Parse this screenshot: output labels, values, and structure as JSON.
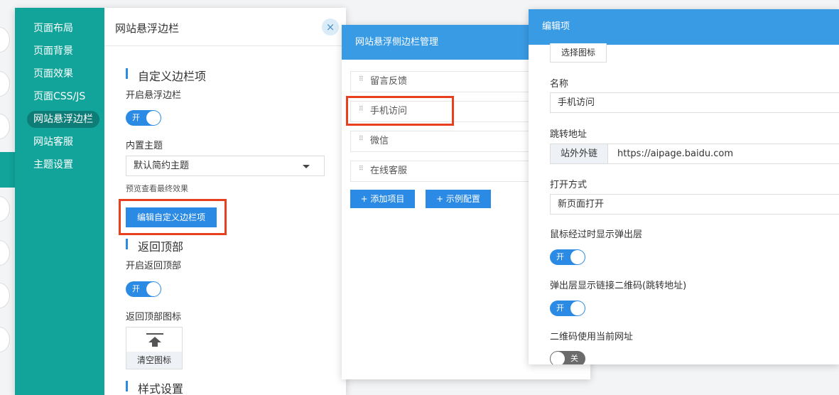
{
  "nav": {
    "items": [
      "页面布局",
      "页面背景",
      "页面效果",
      "页面CSS/JS",
      "网站悬浮边栏",
      "网站客服",
      "主题设置"
    ],
    "active_index": 4
  },
  "main": {
    "title": "网站悬浮边栏",
    "close_icon": "×",
    "section_custom": "自定义边栏项",
    "enable_sidebar_label": "开启悬浮边栏",
    "enable_sidebar_toggle": "开",
    "theme_label": "内置主题",
    "theme_value": "默认简约主题",
    "preview_hint": "预览查看最终效果",
    "edit_button": "编辑自定义边栏项",
    "section_back_top": "返回顶部",
    "enable_back_top_label": "开启返回顶部",
    "enable_back_top_toggle": "开",
    "back_top_icon_label": "返回顶部图标",
    "clear_icon_button": "清空图标",
    "section_style": "样式设置"
  },
  "middle": {
    "title": "网站悬浮侧边栏管理",
    "items": [
      "留言反馈",
      "手机访问",
      "微信",
      "在线客服"
    ],
    "add_button": "+ 添加项目",
    "example_button": "+ 示例配置"
  },
  "right": {
    "title": "编辑项",
    "choose_icon_button": "选择图标",
    "name_label": "名称",
    "name_value": "手机访问",
    "url_label": "跳转地址",
    "url_addon": "站外外链",
    "url_value": "https://aipage.baidu.com",
    "open_label": "打开方式",
    "open_value": "新页面打开",
    "hover_popup_label": "鼠标经过时显示弹出层",
    "hover_popup_toggle": "开",
    "qr_label": "弹出层显示链接二维码(跳转地址)",
    "qr_toggle": "开",
    "current_url_label": "二维码使用当前网址",
    "current_url_toggle": "关"
  },
  "colors": {
    "teal": "#12a49b",
    "blue": "#2b8ae3",
    "header_blue": "#3a9be5",
    "highlight_red": "#e8401f"
  }
}
